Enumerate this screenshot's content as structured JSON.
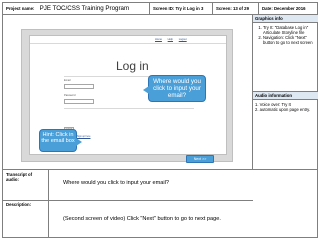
{
  "header": {
    "project_label": "Project name:",
    "project_value": "PJE TOC/CSS Training Program",
    "screen_id": "Screen ID: Try it Log in 3",
    "screen_num": "Screen: 13 of 29",
    "date": "Date: December 2016"
  },
  "screenshot": {
    "top_links": [
      "Home",
      "Help",
      "Logout"
    ],
    "login_title": "Log in",
    "email_label": "Email",
    "password_label": "Password",
    "login_button": "Log in",
    "small_text": "Need help?",
    "small_link": "Sign up here",
    "callout_question": "Where would you click to input your email?",
    "callout_hint": "Hint: Click in the email box",
    "next_button": "Next >>",
    "colors": {
      "callout": "#4a9fd8",
      "callout_border": "#2e75b6"
    }
  },
  "graphics": {
    "title": "Graphics info",
    "items": [
      "Try It: \"Database Log in\" Articulate Storyline file",
      "Navigation: Click \"Next\" button to go to next screen"
    ]
  },
  "audio": {
    "title": "Audio information",
    "line1": "1. Voice over: Try It",
    "line2": "2. automatic upon page entry."
  },
  "bottom": {
    "transcript_label": "Transcript of audio:",
    "transcript_text": "Where would you click to input your email?",
    "description_label": "Description:",
    "description_text": "(Second screen of video) Click \"Next\" button to go to next page."
  }
}
